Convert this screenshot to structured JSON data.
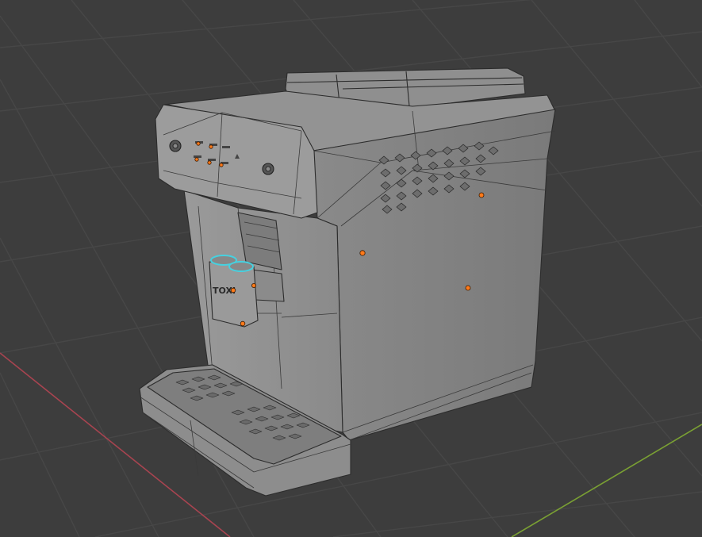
{
  "viewport": {
    "background": "#3d3d3d",
    "grid_color": "#4a4a4a",
    "x_axis_color": "#b04550",
    "y_axis_color": "#7da030"
  },
  "model": {
    "body_color": "#8e8e8e",
    "side_color": "#7f7f7f",
    "edge_color": "#2f2f2f",
    "origin_color": "#ff7a1a",
    "selection_color": "#46d1e0",
    "spout_label": "TOXI"
  }
}
